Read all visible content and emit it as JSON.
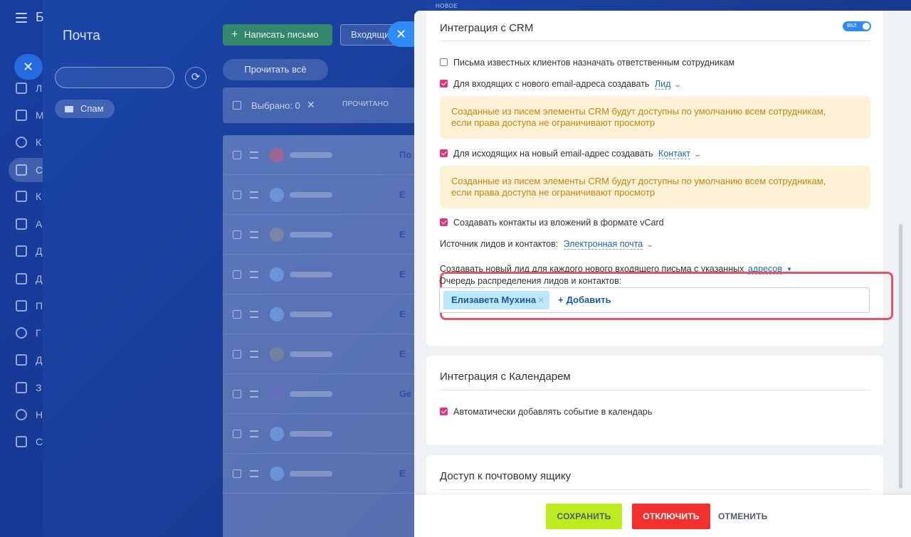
{
  "background": {
    "brand_letter": "Б",
    "rail_letters": [
      "Л",
      "М",
      "К",
      "С",
      "К",
      "А",
      "Д",
      "Д",
      "П",
      "Г",
      "Д",
      "З",
      "Н",
      "С"
    ],
    "mail": {
      "title": "Почта",
      "compose_label": "Написать письмо",
      "inbox_label": "Входящи",
      "read_all_label": "Прочитать всё",
      "spam_label": "Спам",
      "selected_label": "Выбрано: 0",
      "mark_read_label": "ПРОЧИТАНО",
      "row_subjects": [
        "По",
        "E",
        "E",
        "E",
        "E",
        "E",
        "Ge",
        "",
        "E"
      ]
    },
    "top_label": "НОВОЕ"
  },
  "crm": {
    "title": "Интеграция с CRM",
    "toggle_label": "ВКЛ",
    "opt_known_clients": "Письма известных клиентов назначать ответственным сотрудникам",
    "opt_incoming": "Для входящих с нового email-адреса создавать",
    "opt_incoming_value": "Лид",
    "notice_1_line1": "Созданные из писем элементы CRM будут доступны по умолчанию всем сотрудникам,",
    "notice_1_line2": "если права доступа не ограничивают просмотр",
    "opt_outgoing": "Для исходящих на новый email-адрес создавать",
    "opt_outgoing_value": "Контакт",
    "notice_2_line1": "Созданные из писем элементы CRM будут доступны по умолчанию всем сотрудникам,",
    "notice_2_line2": "если права доступа не ограничивают просмотр",
    "opt_vcard": "Создавать контакты из вложений в формате vCard",
    "source_label": "Источник лидов и контактов:",
    "source_value": "Электронная почта",
    "new_lead_label": "Создавать новый лид для каждого нового входящего письма с указанных",
    "new_lead_link": "адресов",
    "queue_label": "Очередь распределения лидов и контактов:",
    "queue_user": "Елизавета Мухина",
    "queue_add": "Добавить"
  },
  "calendar": {
    "title": "Интеграция с Календарем",
    "opt_auto_event": "Автоматически добавлять событие в календарь"
  },
  "access": {
    "title": "Доступ к почтовому ящику"
  },
  "footer": {
    "save": "СОХРАНИТЬ",
    "disable": "ОТКЛЮЧИТЬ",
    "cancel": "ОТМЕНИТЬ"
  },
  "colors": {
    "accent": "#2f8bf5",
    "checkbox_checked": "#e0357d",
    "notice_bg": "#fff1d6",
    "notice_text": "#c1870f",
    "save_button": "#bbed21",
    "disable_button": "#f4302e",
    "highlight_frame": "#e05668"
  }
}
